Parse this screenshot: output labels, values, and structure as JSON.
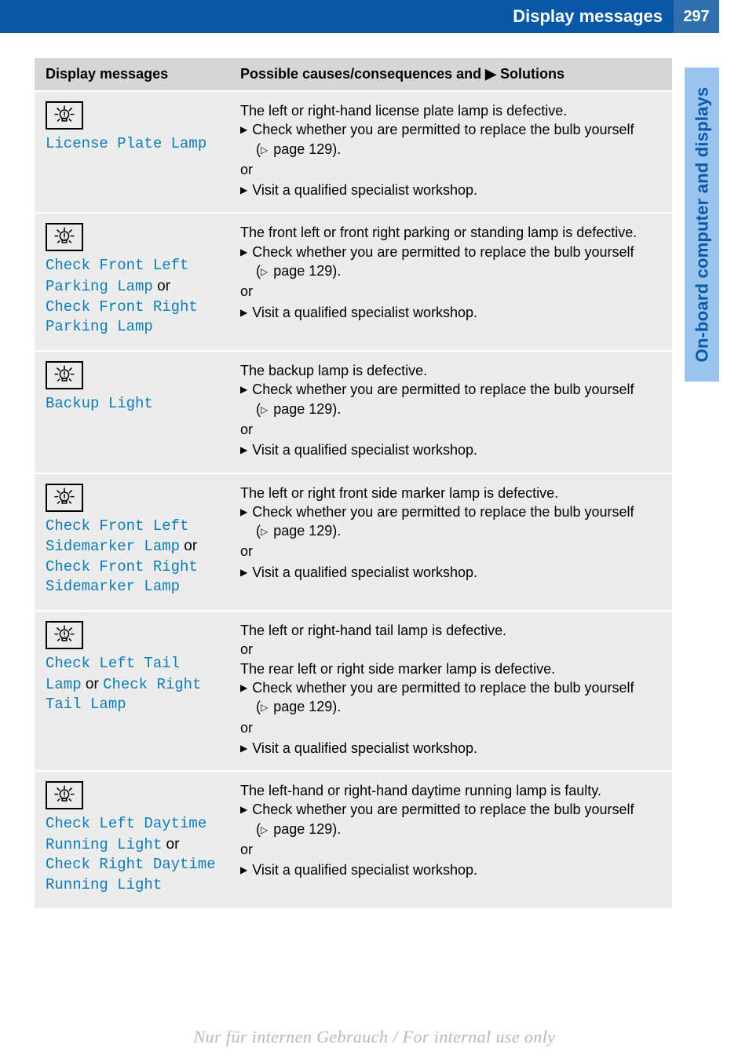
{
  "header": {
    "title": "Display messages",
    "page_number": "297"
  },
  "side_tab": "On-board computer and displays",
  "table": {
    "col1_header": "Display messages",
    "col2_header": "Possible causes/consequences and ▶ Solutions",
    "page_ref": "page 129",
    "rows": [
      {
        "messages": [
          {
            "type": "msg",
            "text": "License Plate Lamp"
          }
        ],
        "cause": "The left or right-hand license plate lamp is defective.",
        "steps": [
          {
            "type": "arrow",
            "text": "Check whether you are permitted to replace the bulb yourself"
          },
          {
            "type": "cont_pgref"
          },
          {
            "type": "or",
            "text": "or"
          },
          {
            "type": "arrow",
            "text": "Visit a qualified specialist workshop."
          }
        ]
      },
      {
        "messages": [
          {
            "type": "msg",
            "text": "Check Front Left Parking Lamp"
          },
          {
            "type": "or",
            "text": "or"
          },
          {
            "type": "msg",
            "text": "Check Front Right Parking Lamp"
          }
        ],
        "cause": "The front left or front right parking or standing lamp is defective.",
        "steps": [
          {
            "type": "arrow",
            "text": "Check whether you are permitted to replace the bulb yourself"
          },
          {
            "type": "cont_pgref"
          },
          {
            "type": "or",
            "text": "or"
          },
          {
            "type": "arrow",
            "text": "Visit a qualified specialist workshop."
          }
        ]
      },
      {
        "messages": [
          {
            "type": "msg",
            "text": "Backup Light"
          }
        ],
        "cause": "The backup lamp is defective.",
        "steps": [
          {
            "type": "arrow",
            "text": "Check whether you are permitted to replace the bulb yourself"
          },
          {
            "type": "cont_pgref"
          },
          {
            "type": "or",
            "text": "or"
          },
          {
            "type": "arrow",
            "text": "Visit a qualified specialist workshop."
          }
        ]
      },
      {
        "messages": [
          {
            "type": "msg",
            "text": "Check Front Left Sidemarker Lamp"
          },
          {
            "type": "or",
            "text": "or"
          },
          {
            "type": "msg",
            "text": "Check Front Right Sidemarker Lamp"
          }
        ],
        "cause": "The left or right front side marker lamp is defective.",
        "steps": [
          {
            "type": "arrow",
            "text": "Check whether you are permitted to replace the bulb yourself"
          },
          {
            "type": "cont_pgref"
          },
          {
            "type": "or",
            "text": "or"
          },
          {
            "type": "arrow",
            "text": "Visit a qualified specialist workshop."
          }
        ]
      },
      {
        "messages": [
          {
            "type": "msg",
            "text": "Check Left Tail Lamp"
          },
          {
            "type": "or",
            "text": "or"
          },
          {
            "type": "msg",
            "text": "Check Right Tail Lamp"
          }
        ],
        "cause": "The left or right-hand tail lamp is defective.",
        "extra": [
          {
            "type": "or",
            "text": "or"
          },
          {
            "type": "plain",
            "text": "The rear left or right side marker lamp is defective."
          }
        ],
        "steps": [
          {
            "type": "arrow",
            "text": "Check whether you are permitted to replace the bulb yourself"
          },
          {
            "type": "cont_pgref"
          },
          {
            "type": "or",
            "text": "or"
          },
          {
            "type": "arrow",
            "text": "Visit a qualified specialist workshop."
          }
        ]
      },
      {
        "messages": [
          {
            "type": "msg",
            "text": "Check Left Daytime Running Light"
          },
          {
            "type": "or",
            "text": "or"
          },
          {
            "type": "msg",
            "text": "Check Right Daytime Running Light"
          }
        ],
        "cause": "The left-hand or right-hand daytime running lamp is faulty.",
        "steps": [
          {
            "type": "arrow",
            "text": "Check whether you are permitted to replace the bulb yourself"
          },
          {
            "type": "cont_pgref"
          },
          {
            "type": "or",
            "text": "or"
          },
          {
            "type": "arrow",
            "text": "Visit a qualified specialist workshop."
          }
        ]
      }
    ]
  },
  "footer": "Nur für internen Gebrauch / For internal use only"
}
